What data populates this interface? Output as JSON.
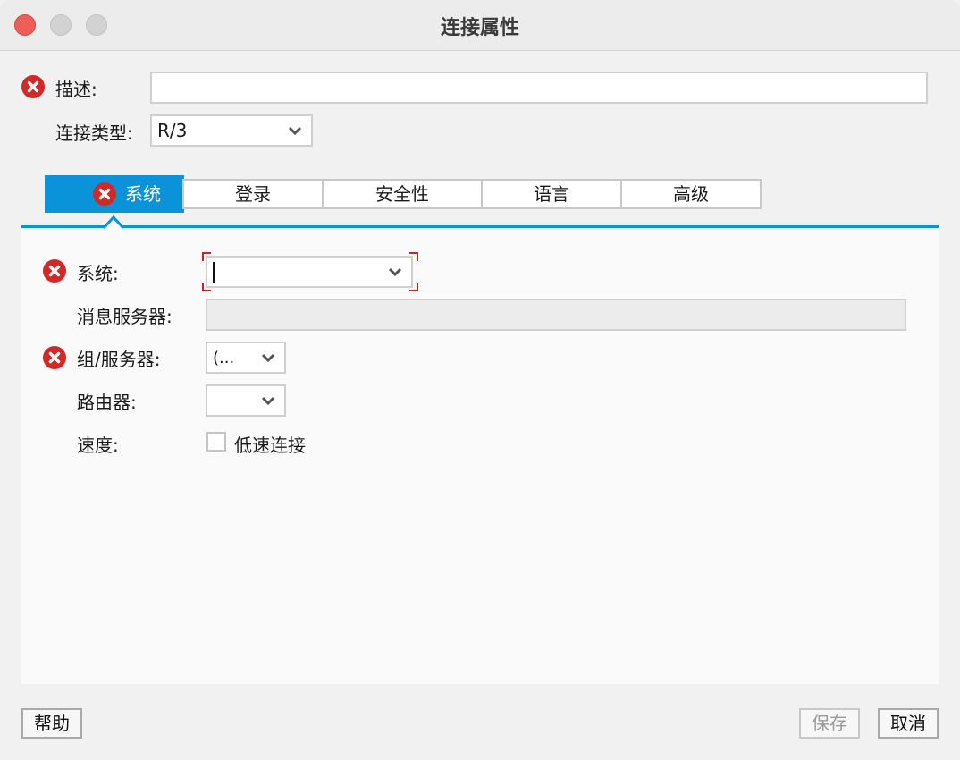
{
  "window": {
    "title": "连接属性"
  },
  "form": {
    "description_label": "描述:",
    "description_value": "",
    "connection_type_label": "连接类型:",
    "connection_type_value": "R/3"
  },
  "tabs": [
    {
      "label": "系统",
      "active": true,
      "error": true
    },
    {
      "label": "登录"
    },
    {
      "label": "安全性"
    },
    {
      "label": "语言"
    },
    {
      "label": "高级"
    }
  ],
  "system_tab": {
    "system_label": "系统:",
    "system_value": "",
    "message_server_label": "消息服务器:",
    "message_server_value": "",
    "group_server_label": "组/服务器:",
    "group_server_value": "(...",
    "router_label": "路由器:",
    "router_value": "",
    "speed_label": "速度:",
    "low_speed_label": "低速连接",
    "low_speed_checked": false
  },
  "footer": {
    "help_label": "帮助",
    "save_label": "保存",
    "cancel_label": "取消"
  },
  "colors": {
    "accent": "#0a93d8",
    "error": "#d22828",
    "close_button": "#ee5f57"
  }
}
